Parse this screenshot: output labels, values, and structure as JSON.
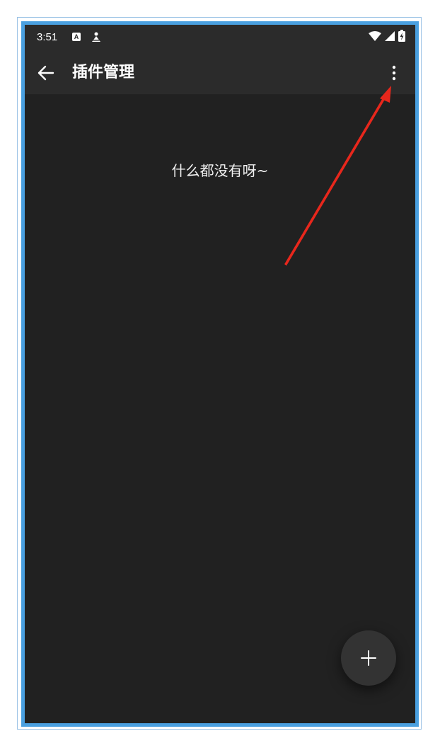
{
  "status_bar": {
    "time": "3:51",
    "notification_badge": "A",
    "icons": [
      "notification-a-icon",
      "person-icon",
      "wifi-icon",
      "cell-signal-icon",
      "battery-charging-icon"
    ]
  },
  "app_bar": {
    "title": "插件管理",
    "back_icon": "back-arrow-icon",
    "menu_icon": "more-vertical-icon"
  },
  "content": {
    "empty_message": "什么都没有呀~"
  },
  "fab": {
    "icon": "plus-icon"
  },
  "colors": {
    "background": "#212121",
    "bar": "#2b2b2b",
    "fab": "#333333",
    "annotation": "#e8271c",
    "frame": "#4aa0e0"
  }
}
